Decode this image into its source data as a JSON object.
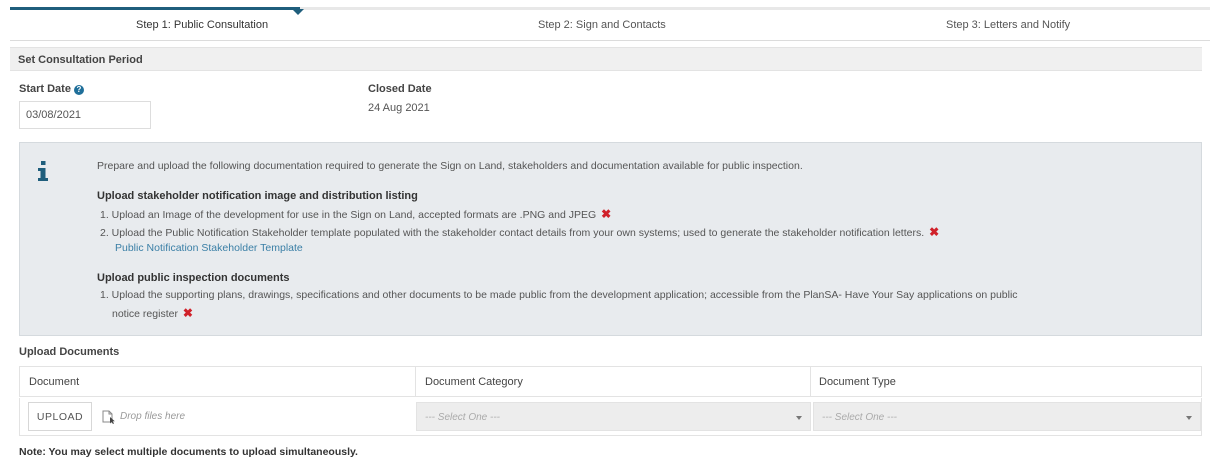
{
  "stepper": {
    "steps": [
      {
        "label": "Step 1: Public Consultation",
        "active": true
      },
      {
        "label": "Step 2: Sign and Contacts",
        "active": false
      },
      {
        "label": "Step 3: Letters and Notify",
        "active": false
      }
    ]
  },
  "section": {
    "title": "Set Consultation Period"
  },
  "start_date": {
    "label": "Start Date",
    "help_icon": "info",
    "value": "03/08/2021"
  },
  "closed_date": {
    "label": "Closed Date",
    "value": "24 Aug 2021"
  },
  "info_panel": {
    "icon": "info-icon",
    "intro": "Prepare and upload the following documentation required to generate the Sign on Land, stakeholders and documentation available for public inspection.",
    "group1": {
      "heading": "Upload stakeholder notification image and distribution listing",
      "items": [
        "1. Upload an Image of the development for use in the Sign on Land, accepted formats are .PNG and JPEG",
        "2. Upload the Public Notification Stakeholder template populated with the stakeholder contact details from your own systems; used to generate the stakeholder notification letters."
      ],
      "link": "Public Notification Stakeholder Template"
    },
    "group2": {
      "heading": "Upload public inspection documents",
      "item_line1": "1. Upload the supporting plans, drawings, specifications and other documents to be  made public from the development application; accessible from the PlanSA- Have Your Say applications on public",
      "item_line2": "notice register"
    },
    "status_mark": "✖"
  },
  "upload": {
    "title": "Upload Documents",
    "columns": [
      "Document",
      "Document Category",
      "Document Type"
    ],
    "upload_button": "UPLOAD",
    "drop_text": "Drop files here",
    "category_placeholder": "--- Select One ---",
    "type_placeholder": "--- Select One ---"
  },
  "note": "Note: You may select multiple documents to upload simultaneously.",
  "colors": {
    "accent": "#1f5e7c",
    "error": "#d0212a",
    "link": "#3a7fa6",
    "panel": "#e8ebee"
  }
}
